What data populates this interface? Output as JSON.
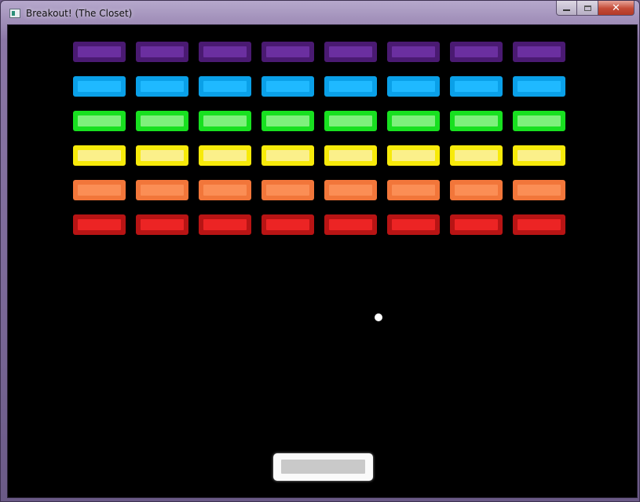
{
  "window": {
    "title": "Breakout! (The Closet)",
    "icon": "app-window-icon",
    "buttons": {
      "minimize_icon": "minimize-icon",
      "maximize_icon": "maximize-icon",
      "close_glyph": "✕"
    }
  },
  "game": {
    "background": "#000000",
    "brick_rows": [
      {
        "name": "purple",
        "outer": "#4a1a72",
        "inner": "#6b2fa0",
        "count": 8
      },
      {
        "name": "blue",
        "outer": "#0aa0e8",
        "inner": "#1fb9ff",
        "count": 8
      },
      {
        "name": "green",
        "outer": "#18e020",
        "inner": "#7ef07c",
        "count": 8
      },
      {
        "name": "yellow",
        "outer": "#f7ea0a",
        "inner": "#fbf08a",
        "count": 8
      },
      {
        "name": "orange",
        "outer": "#f2763a",
        "inner": "#fb8e55",
        "count": 8
      },
      {
        "name": "red",
        "outer": "#b81414",
        "inner": "#ec2424",
        "count": 8
      }
    ],
    "ball_color": "#ffffff",
    "paddle": {
      "outer": "#fafafa",
      "inner": "#c9c9c9"
    }
  }
}
